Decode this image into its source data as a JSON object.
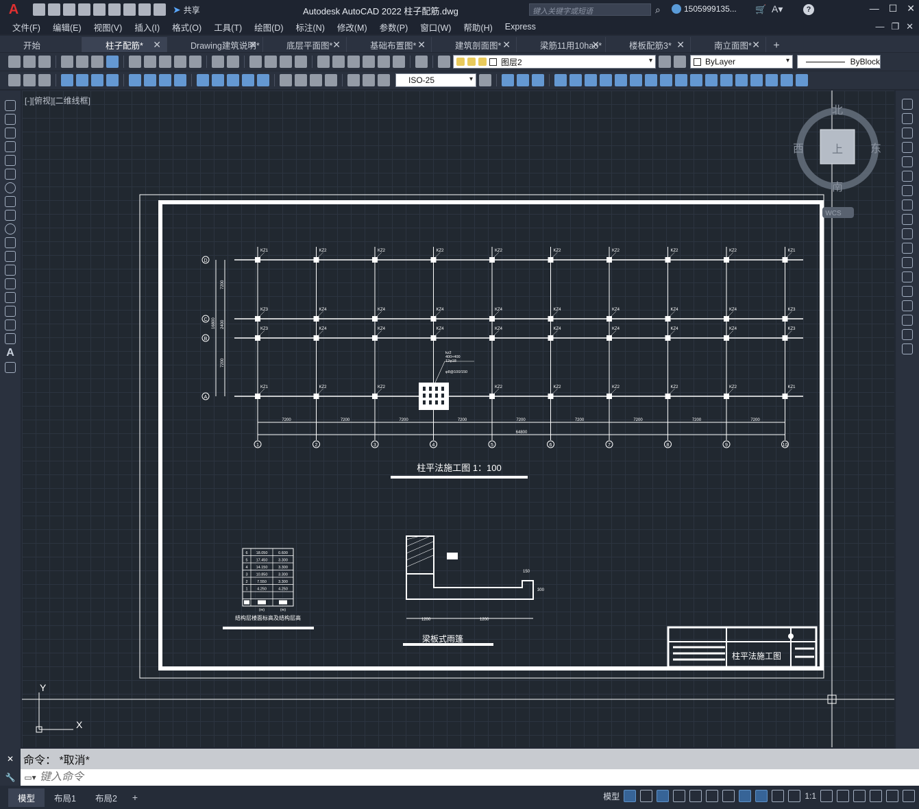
{
  "app": {
    "logo": "A",
    "title": "Autodesk AutoCAD 2022    柱子配筋.dwg",
    "share_label": "共享",
    "search_placeholder": "键入关键字或短语",
    "user_label": "1505999135...",
    "help_label": "?"
  },
  "menu": [
    "文件(F)",
    "编辑(E)",
    "视图(V)",
    "插入(I)",
    "格式(O)",
    "工具(T)",
    "绘图(D)",
    "标注(N)",
    "修改(M)",
    "参数(P)",
    "窗口(W)",
    "帮助(H)",
    "Express"
  ],
  "tabs": [
    {
      "label": "开始",
      "active": false,
      "closable": false
    },
    {
      "label": "柱子配筋*",
      "active": true,
      "closable": true
    },
    {
      "label": "Drawing建筑说明*",
      "active": false,
      "closable": true
    },
    {
      "label": "底层平面图*",
      "active": false,
      "closable": true
    },
    {
      "label": "基础布置图*",
      "active": false,
      "closable": true
    },
    {
      "label": "建筑剖面图*",
      "active": false,
      "closable": true
    },
    {
      "label": "梁筋11用10hao*",
      "active": false,
      "closable": true
    },
    {
      "label": "楼板配筋3*",
      "active": false,
      "closable": true
    },
    {
      "label": "南立面图*",
      "active": false,
      "closable": true
    }
  ],
  "toolbar": {
    "layer_name": "图层2",
    "color_value": "ByLayer",
    "linetype_value": "ByBlock",
    "dimstyle_value": "ISO-25"
  },
  "canvas": {
    "view_label": "[-][俯视][二维线框]",
    "viewcube": {
      "north": "北",
      "south": "南",
      "east": "东",
      "west": "西",
      "face": "上",
      "wcs": "WCS"
    },
    "ucs": {
      "x": "X",
      "y": "Y"
    },
    "drawing": {
      "title_main": "柱平法施工图   1：100",
      "title_canopy": "梁板式雨篷",
      "title_table": "结构层楼面标高及结构层高",
      "titleblock_name": "柱平法施工图",
      "axes_numbers": [
        "1",
        "2",
        "3",
        "4",
        "5",
        "6",
        "7",
        "8",
        "9",
        "10"
      ],
      "axes_letters": [
        "D",
        "C",
        "B",
        "A"
      ],
      "span_label": "7200",
      "total_label": "64800",
      "col_top": "KZ1",
      "col_mid": "KZ2",
      "col_mid2": "KZ3",
      "col_inner": "KZ4",
      "section_note1": "kz2",
      "section_note2": "400×400",
      "section_note3": "12φ18",
      "section_note4": "φ8@100/150",
      "dim_left_top": "7200",
      "dim_left_mid": "2400",
      "dim_left_bot": "7200",
      "dim_left_total": "16800",
      "canopy_dim1": "1200",
      "canopy_dim2": "1200",
      "canopy_dim3": "150",
      "canopy_dim4": "300",
      "floor_table": [
        [
          "6",
          "18.050",
          "0.600"
        ],
        [
          "5",
          "17.450",
          "3.300"
        ],
        [
          "4",
          "14.150",
          "3.300"
        ],
        [
          "3",
          "10.850",
          "3.300"
        ],
        [
          "2",
          "7.550",
          "3.300"
        ],
        [
          "1",
          "4.250",
          "4.250"
        ]
      ],
      "floor_table_foot": [
        "(m)",
        "(m)"
      ]
    }
  },
  "command": {
    "history": "命令：  *取消*",
    "placeholder": "键入命令"
  },
  "status": {
    "layouts": [
      {
        "label": "模型",
        "active": true
      },
      {
        "label": "布局1",
        "active": false
      },
      {
        "label": "布局2",
        "active": false
      }
    ],
    "model_label": "模型",
    "scale_label": "1:1"
  }
}
